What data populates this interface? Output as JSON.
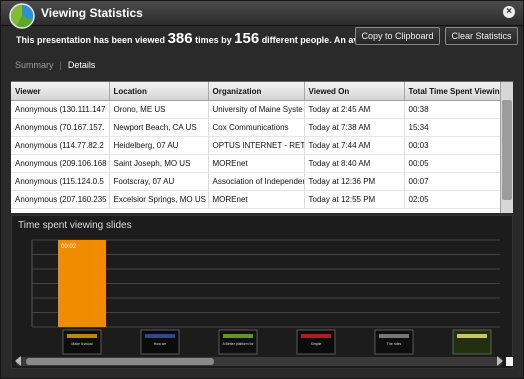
{
  "window": {
    "title": "Viewing Statistics",
    "close_glyph": "×"
  },
  "summary": {
    "prefix": "This presentation has been viewed",
    "views": "386",
    "middle": "times by",
    "people": "156",
    "suffix": "different people. An average"
  },
  "buttons": {
    "copy": "Copy to Clipboard",
    "clear": "Clear Statistics"
  },
  "tabs": {
    "summary": "Summary",
    "separator": "|",
    "details": "Details"
  },
  "table": {
    "headers": [
      "Viewer",
      "Location",
      "Organization",
      "Viewed On",
      "Total Time Spent Viewin"
    ],
    "rows": [
      [
        "Anonymous (130.111.147",
        "Orono, ME US",
        "University of Maine Syste",
        "Today at 2:45 AM",
        "00:38"
      ],
      [
        "Anonymous (70.167.157.",
        "Newport Beach, CA US",
        "Cox Communications",
        "Today at 7:38 AM",
        "15:34"
      ],
      [
        "Anonymous (114.77.82.2",
        "Heidelberg, 07 AU",
        "OPTUS INTERNET - RETAI",
        "Today at 7:44 AM",
        "00:03"
      ],
      [
        "Anonymous (209.106.168",
        "Saint Joseph, MO US",
        "MOREnet",
        "Today at 8:40 AM",
        "00:05"
      ],
      [
        "Anonymous (115.124.0.5",
        "Footscray, 07 AU",
        "Association of Independer",
        "Today at 12:36 PM",
        "00:07"
      ],
      [
        "Anonymous (207.160.235",
        "Excelsior Springs, MO US",
        "MOREnet",
        "Today at 12:55 PM",
        "02:05"
      ]
    ]
  },
  "chart_data": {
    "type": "bar",
    "title": "Time spent viewing slides",
    "bar_color": "#f08c00",
    "bars": [
      {
        "label": "00:02",
        "value": 1.0
      }
    ],
    "thumbnails": [
      {
        "caption": "Make it visual",
        "bg": "#0d0d0d",
        "accent": "#d9a200"
      },
      {
        "caption": "How we",
        "bg": "#0b0b0b",
        "accent": "#3355aa"
      },
      {
        "caption": "A Better platform for creating social networks",
        "bg": "#101010",
        "accent": "#77aa22"
      },
      {
        "caption": "Simple",
        "bg": "#0c0c0c",
        "accent": "#cc2222"
      },
      {
        "caption": "The rules",
        "bg": "#0e0e0e",
        "accent": "#888888"
      },
      {
        "caption": "",
        "bg": "#233010",
        "accent": "#e8e070"
      }
    ]
  },
  "icons": {
    "logo": "app-logo-icon",
    "close": "close-icon"
  }
}
